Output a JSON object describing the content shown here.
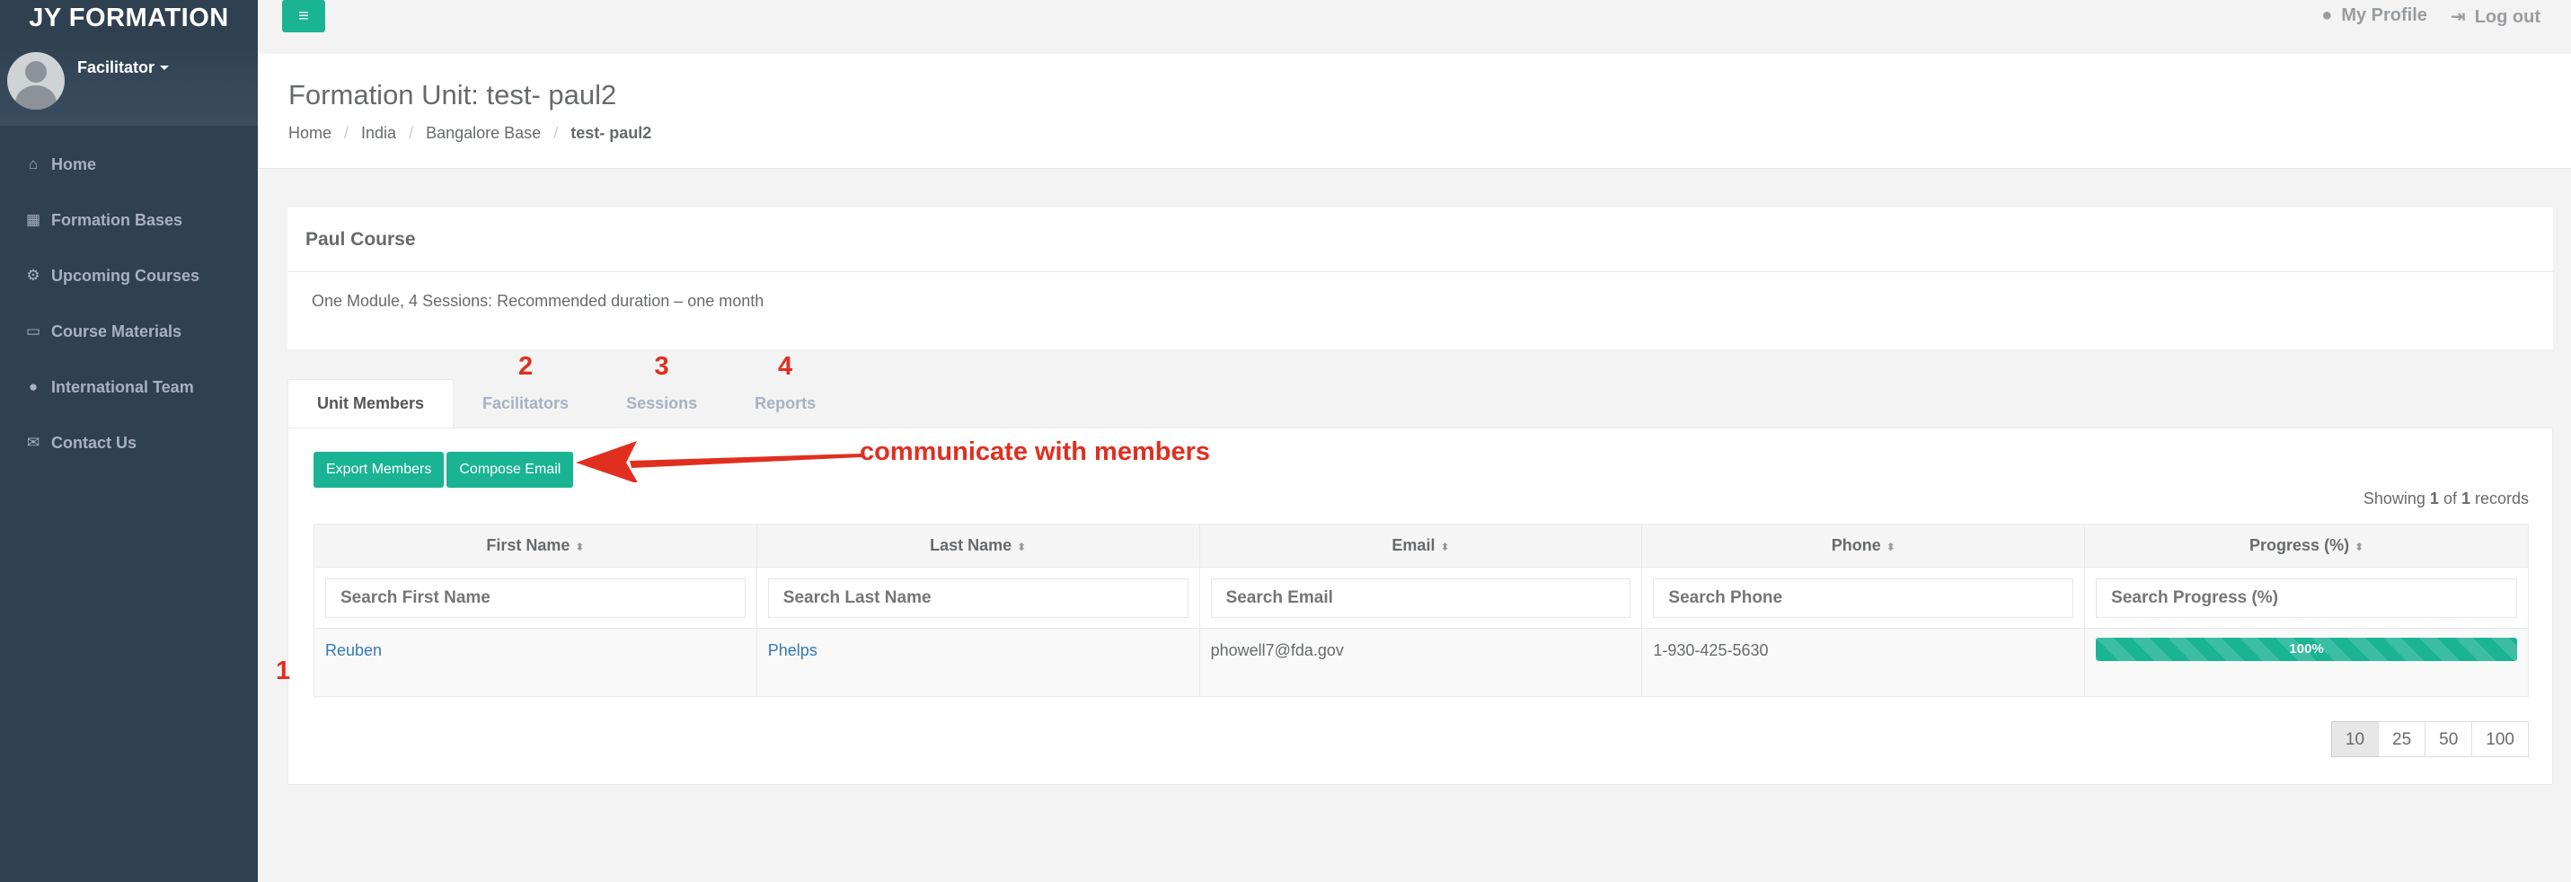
{
  "sidebar": {
    "brand": "JY FORMATION",
    "role": "Facilitator",
    "items": [
      {
        "label": "Home",
        "icon": "home-icon"
      },
      {
        "label": "Formation Bases",
        "icon": "grid-icon"
      },
      {
        "label": "Upcoming Courses",
        "icon": "bicycle-icon"
      },
      {
        "label": "Course Materials",
        "icon": "document-icon"
      },
      {
        "label": "International Team",
        "icon": "globe-icon"
      },
      {
        "label": "Contact Us",
        "icon": "chat-icon"
      }
    ]
  },
  "topbar": {
    "profile": "My Profile",
    "logout": "Log out"
  },
  "heading": {
    "title": "Formation Unit: test- paul2",
    "breadcrumb": [
      "Home",
      "India",
      "Bangalore Base",
      "test- paul2"
    ]
  },
  "course": {
    "title": "Paul Course",
    "description": "One Module, 4 Sessions: Recommended duration – one month"
  },
  "tabs": [
    {
      "label": "Unit Members",
      "marker": ""
    },
    {
      "label": "Facilitators",
      "marker": "2"
    },
    {
      "label": "Sessions",
      "marker": "3"
    },
    {
      "label": "Reports",
      "marker": "4"
    }
  ],
  "actions": {
    "export": "Export Members",
    "compose": "Compose Email"
  },
  "annotation": "communicate with members",
  "showing": {
    "prefix": "Showing ",
    "from": "1",
    "of": " of ",
    "total": "1",
    "suffix": " records"
  },
  "table": {
    "headers": [
      "First Name",
      "Last Name",
      "Email",
      "Phone",
      "Progress (%)"
    ],
    "placeholders": [
      "Search First Name",
      "Search Last Name",
      "Search Email",
      "Search Phone",
      "Search Progress (%)"
    ],
    "rows": [
      {
        "marker": "1",
        "first": "Reuben",
        "last": "Phelps",
        "email": "phowell7@fda.gov",
        "phone": "1-930-425-5630",
        "progress": "100%",
        "progress_value": 100
      }
    ]
  },
  "pager": [
    "10",
    "25",
    "50",
    "100"
  ],
  "colors": {
    "accent": "#1ab394",
    "sidebar": "#2f4050",
    "annotation": "#e02f1f"
  }
}
